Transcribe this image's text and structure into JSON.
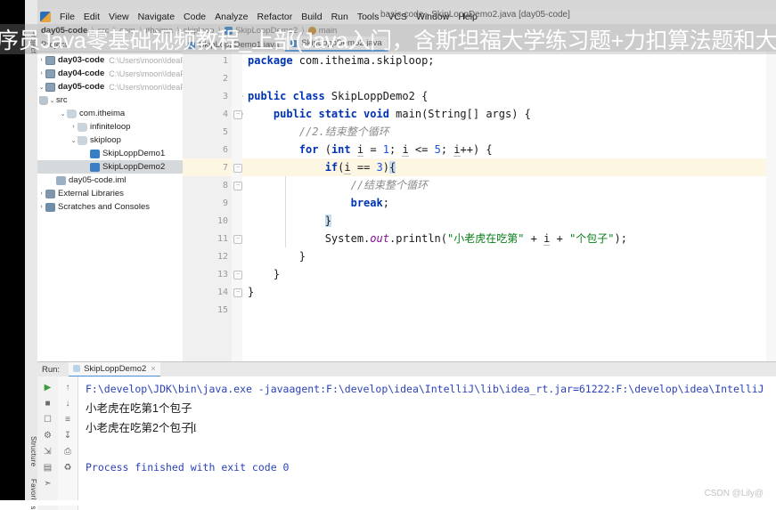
{
  "window": {
    "title": "basic-code - SkipLoppDemo2.java [day05-code]"
  },
  "menu": {
    "logo_icon": "intellij-logo-icon",
    "items": [
      "File",
      "Edit",
      "View",
      "Navigate",
      "Code",
      "Analyze",
      "Refactor",
      "Build",
      "Run",
      "Tools",
      "VCS",
      "Window",
      "Help"
    ]
  },
  "breadcrumb": {
    "items": [
      {
        "label": "day05-code",
        "strong": true,
        "icon": ""
      },
      {
        "label": "src",
        "strong": false,
        "icon": ""
      },
      {
        "label": "com",
        "strong": false,
        "icon": ""
      },
      {
        "label": "itheima",
        "strong": false,
        "icon": ""
      },
      {
        "label": "skiploop",
        "strong": false,
        "icon": ""
      },
      {
        "label": "SkipLoppDemo2",
        "strong": false,
        "icon": "class-icon"
      },
      {
        "label": "main",
        "strong": false,
        "icon": "method-icon"
      }
    ]
  },
  "rail": {
    "project_tab": "Project",
    "structure_tab": "Structure",
    "favorites_tab": "Favorites"
  },
  "project": {
    "header": "Project",
    "tree": [
      {
        "indent": 0,
        "arrow": "›",
        "icon": "module-icon",
        "label": "day03-code",
        "bold": true,
        "path": "C:\\Users\\moon\\IdeaProje"
      },
      {
        "indent": 0,
        "arrow": "›",
        "icon": "module-icon",
        "label": "day04-code",
        "bold": true,
        "path": "C:\\Users\\moon\\IdeaProje"
      },
      {
        "indent": 0,
        "arrow": "⌄",
        "icon": "module-icon",
        "label": "day05-code",
        "bold": true,
        "path": "C:\\Users\\moon\\IdeaProje"
      },
      {
        "indent": 1,
        "arrow": "⌄",
        "icon": "source-folder-icon",
        "label": "src",
        "bold": false,
        "path": ""
      },
      {
        "indent": 2,
        "arrow": "⌄",
        "icon": "package-icon",
        "label": "com.itheima",
        "bold": false,
        "path": ""
      },
      {
        "indent": 3,
        "arrow": "›",
        "icon": "package-icon",
        "label": "infiniteloop",
        "bold": false,
        "path": ""
      },
      {
        "indent": 3,
        "arrow": "⌄",
        "icon": "package-icon",
        "label": "skiploop",
        "bold": false,
        "path": ""
      },
      {
        "indent": 4,
        "arrow": "",
        "icon": "class-icon",
        "label": "SkipLoppDemo1",
        "bold": false,
        "path": ""
      },
      {
        "indent": 4,
        "arrow": "",
        "icon": "class-icon",
        "label": "SkipLoppDemo2",
        "bold": false,
        "path": "",
        "selected": true
      },
      {
        "indent": 1,
        "arrow": "",
        "icon": "iml-icon",
        "label": "day05-code.iml",
        "bold": false,
        "path": ""
      },
      {
        "indent": 0,
        "arrow": "›",
        "icon": "library-icon",
        "label": "External Libraries",
        "bold": false,
        "path": ""
      },
      {
        "indent": 0,
        "arrow": "›",
        "icon": "scratches-icon",
        "label": "Scratches and Consoles",
        "bold": false,
        "path": ""
      }
    ]
  },
  "editor": {
    "tabs": [
      {
        "label": "SkipLoppDemo1.java",
        "active": false,
        "icon": "class-icon"
      },
      {
        "label": "SkipLoppDemo2.java",
        "active": true,
        "icon": "class-icon"
      }
    ],
    "line_numbers": [
      "1",
      "2",
      "3",
      "4",
      "5",
      "6",
      "7",
      "8",
      "9",
      "10",
      "11",
      "12",
      "13",
      "14",
      "15"
    ],
    "run_arrow_lines": [
      3,
      4
    ],
    "highlight_line": 7,
    "fold_lines": [
      4,
      6,
      7,
      10,
      12,
      13
    ],
    "code_lines": [
      "package com.itheima.skiploop;",
      "",
      "public class SkipLoppDemo2 {",
      "    public static void main(String[] args) {",
      "        //2.结束整个循环",
      "        for (int i = 1; i <= 5; i++) {",
      "            if(i == 3){",
      "                //结束整个循环",
      "                break;",
      "            }",
      "            System.out.println(\"小老虎在吃第\" + i + \"个包子\");",
      "        }",
      "    }",
      "}",
      ""
    ]
  },
  "run": {
    "title": "Run:",
    "tab_label": "SkipLoppDemo2",
    "close_glyph": "×",
    "tools_left": [
      "run-icon",
      "stop-icon",
      "camera-icon",
      "bug-icon",
      "export-icon",
      "layout-icon",
      "pin-icon"
    ],
    "tools_right": [
      "scroll-up-icon",
      "scroll-down-icon",
      "soft-wrap-icon",
      "scroll-to-end-icon",
      "print-icon",
      "trash-icon"
    ],
    "console": {
      "command": "F:\\develop\\JDK\\bin\\java.exe -javaagent:F:\\develop\\idea\\IntelliJ\\lib\\idea_rt.jar=61222:F:\\develop\\idea\\IntelliJ",
      "output_lines": [
        "小老虎在吃第1个包子",
        "小老虎在吃第2个包子"
      ],
      "finish": "Process finished with exit code 0",
      "caret_glyph": "I"
    }
  },
  "overlay": {
    "banner_text": "序员Java零基础视频教程_上部(Java入门，含斯坦福大学练习题+力扣算法题和大厂java面试题)",
    "watermark": "CSDN @Lily@"
  },
  "colors": {
    "accent": "#4a90d9",
    "keyword": "#0033b3",
    "string": "#067d17",
    "comment": "#8c8c8c",
    "number": "#1750eb",
    "run_green": "#3c9a3c",
    "console_blue": "#2a42b8"
  }
}
